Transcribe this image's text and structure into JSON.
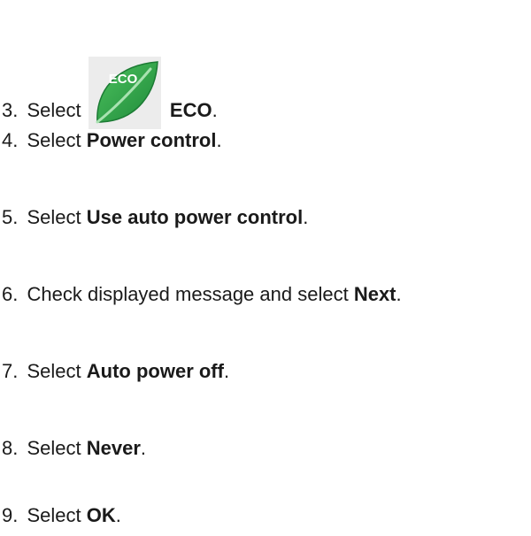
{
  "steps": [
    {
      "number": "3.",
      "prefix": "Select",
      "bold": "ECO",
      "suffix": ".",
      "icon": "eco-leaf-icon",
      "icon_text": "ECO",
      "icon_color": "#2e9e46"
    },
    {
      "number": "4.",
      "prefix": "Select",
      "bold": "Power control",
      "suffix": "."
    },
    {
      "number": "5.",
      "prefix": "Select",
      "bold": "Use auto power control",
      "suffix": "."
    },
    {
      "number": "6.",
      "prefix": "Check displayed message and select",
      "bold": "Next",
      "suffix": "."
    },
    {
      "number": "7.",
      "prefix": "Select",
      "bold": "Auto power off",
      "suffix": "."
    },
    {
      "number": "8.",
      "prefix": "Select",
      "bold": "Never",
      "suffix": "."
    },
    {
      "number": "9.",
      "prefix": "Select",
      "bold": "OK",
      "suffix": "."
    }
  ]
}
